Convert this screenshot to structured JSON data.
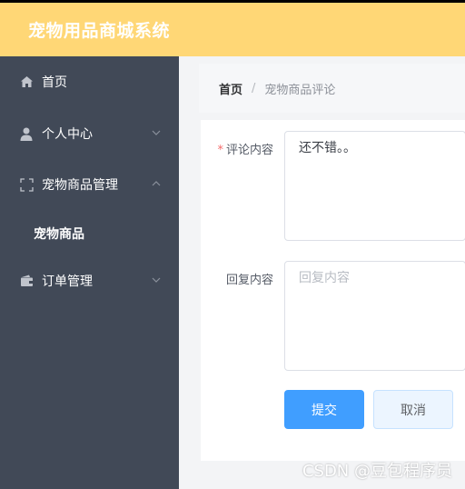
{
  "app": {
    "title": "宠物用品商城系统"
  },
  "sidebar": {
    "items": [
      {
        "label": "首页",
        "icon": "home-icon"
      },
      {
        "label": "个人中心",
        "icon": "user-icon",
        "expanded": false
      },
      {
        "label": "宠物商品管理",
        "icon": "fullscreen-icon",
        "expanded": true
      },
      {
        "label": "订单管理",
        "icon": "wallet-icon",
        "expanded": false
      }
    ],
    "submenu": [
      {
        "label": "宠物商品"
      }
    ]
  },
  "breadcrumb": {
    "home": "首页",
    "separator": "/",
    "current": "宠物商品评论"
  },
  "form": {
    "comment": {
      "label": "评论内容",
      "required_mark": "*",
      "value": "还不错。。"
    },
    "reply": {
      "label": "回复内容",
      "value": "",
      "placeholder": "回复内容"
    },
    "submit_label": "提交",
    "cancel_label": "取消"
  },
  "watermark": "CSDN @豆包程序员",
  "colors": {
    "header_bg": "#ffd776",
    "sidebar_bg": "#414957",
    "primary": "#409eff"
  }
}
